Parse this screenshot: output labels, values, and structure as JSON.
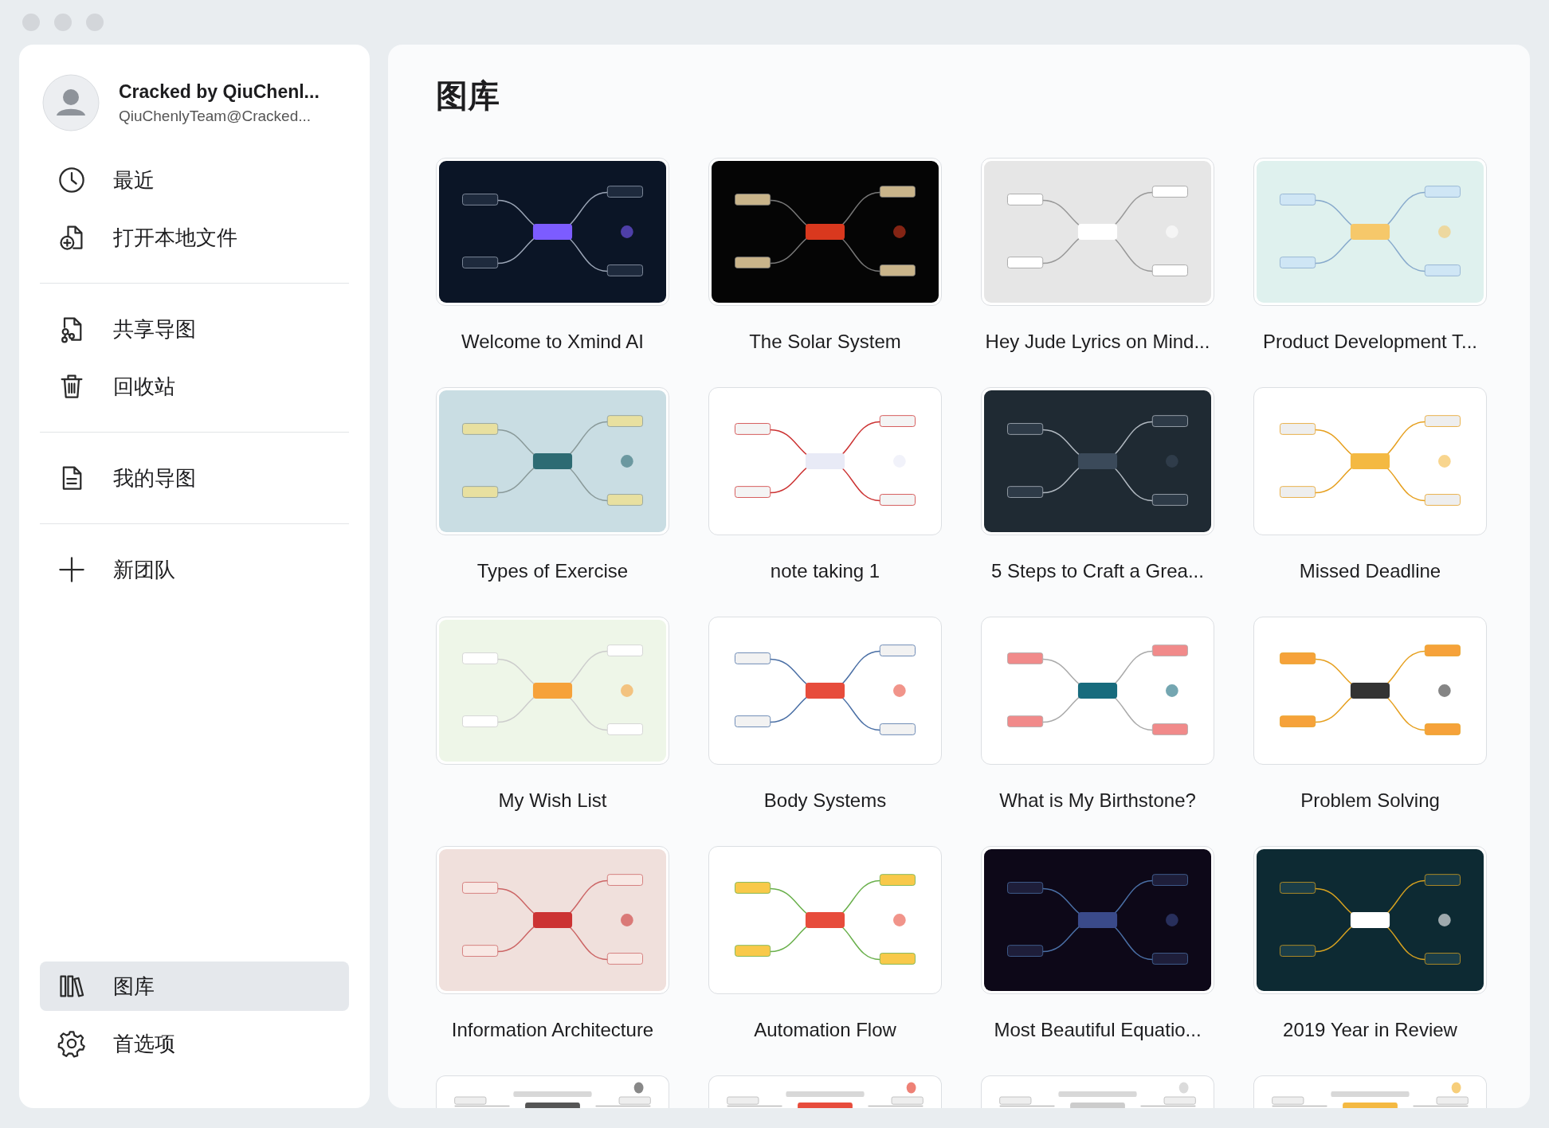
{
  "user": {
    "name": "Cracked by QiuChenl...",
    "email": "QiuChenlyTeam@Cracked..."
  },
  "nav_groups": [
    {
      "items": [
        {
          "label": "最近",
          "kind": "recent",
          "selected": false
        },
        {
          "label": "打开本地文件",
          "kind": "open",
          "selected": false
        }
      ]
    },
    {
      "items": [
        {
          "label": "共享导图",
          "kind": "shared",
          "selected": false
        },
        {
          "label": "回收站",
          "kind": "trash",
          "selected": false
        }
      ]
    },
    {
      "items": [
        {
          "label": "我的导图",
          "kind": "mine",
          "selected": false
        }
      ]
    },
    {
      "items": [
        {
          "label": "新团队",
          "kind": "team",
          "selected": false
        }
      ]
    }
  ],
  "bottom_nav": [
    {
      "label": "图库",
      "kind": "gallery",
      "selected": true
    },
    {
      "label": "首选项",
      "kind": "settings",
      "selected": false
    }
  ],
  "gallery": {
    "title": "图库",
    "items": [
      {
        "kind": "picture",
        "title": "Welcome to Xmind AI"
      },
      {
        "kind": "picture",
        "title": "The Solar System"
      },
      {
        "kind": "picture",
        "title": "Hey Jude Lyrics on Mind..."
      },
      {
        "kind": "picture",
        "title": "Product Development T..."
      },
      {
        "kind": "picture",
        "title": "Types of Exercise"
      },
      {
        "kind": "picture",
        "title": "note taking 1"
      },
      {
        "kind": "picture",
        "title": "5 Steps to Craft a Grea..."
      },
      {
        "kind": "picture",
        "title": "Missed Deadline"
      },
      {
        "kind": "picture",
        "title": "My Wish List"
      },
      {
        "kind": "picture",
        "title": "Body Systems"
      },
      {
        "kind": "picture",
        "title": "What is My Birthstone?"
      },
      {
        "kind": "picture",
        "title": "Problem Solving"
      },
      {
        "kind": "picture",
        "title": "Information Architecture"
      },
      {
        "kind": "picture",
        "title": "Automation Flow"
      },
      {
        "kind": "picture",
        "title": "Most Beautiful Equatio..."
      },
      {
        "kind": "picture",
        "title": "2019 Year in Review"
      },
      {
        "kind": "picture"
      },
      {
        "kind": "picture"
      },
      {
        "kind": "picture"
      },
      {
        "kind": "picture"
      }
    ]
  }
}
